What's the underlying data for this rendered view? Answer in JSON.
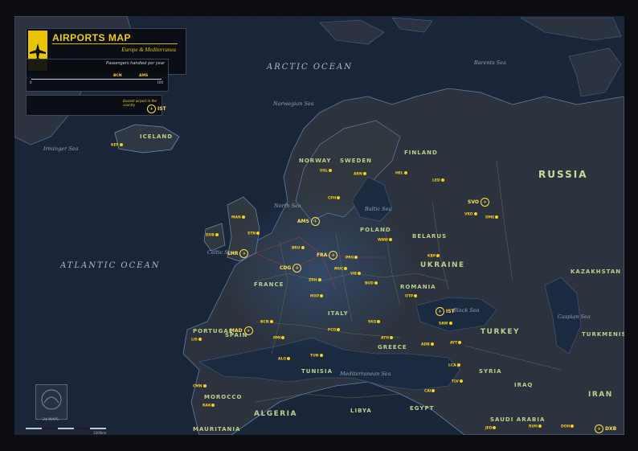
{
  "legend": {
    "title": "AIRPORTS MAP",
    "subtitle": "Europe & Mediterranea",
    "pax_caption": "Passengers handled per year",
    "pax_ticks": [
      "0",
      "100"
    ],
    "pax_marks": [
      "BCN",
      "AMS"
    ],
    "busy_caption": "Busiest airport in the country",
    "busy_code": "IST"
  },
  "oceans": {
    "arctic": "ARCTIC OCEAN",
    "atlantic": "ATLANTIC OCEAN"
  },
  "seas": {
    "barents": "Barents Sea",
    "norwegian": "Norwegian Sea",
    "irminger": "Irminger Sea",
    "north": "North Sea",
    "baltic": "Baltic Sea",
    "celtic": "Celtic Sea",
    "black": "Black Sea",
    "mediterranean": "Mediterranean Sea",
    "caspian": "Caspian Sea"
  },
  "countries": {
    "russia": "RUSSIA",
    "kazakhstan": "KAZAKHSTAN",
    "finland": "FINLAND",
    "sweden": "SWEDEN",
    "norway": "NORWAY",
    "iceland": "ICELAND",
    "ukraine": "UKRAINE",
    "poland": "POLAND",
    "belarus": "BELARUS",
    "france": "FRANCE",
    "spain": "SPAIN",
    "portugal": "PORTUGAL",
    "italy": "ITALY",
    "romania": "ROMANIA",
    "greece": "GREECE",
    "turkey": "TURKEY",
    "syria": "SYRIA",
    "iraq": "IRAQ",
    "iran": "IRAN",
    "turkmenistan": "TURKMENISTAN",
    "morocco": "MOROCCO",
    "algeria": "ALGERIA",
    "tunisia": "TUNISIA",
    "libya": "LIBYA",
    "egypt": "EGYPT",
    "saudi": "SAUDI ARABIA",
    "mauritania": "MAURITANIA"
  },
  "hubs": [
    {
      "code": "AMS"
    },
    {
      "code": "FRA"
    },
    {
      "code": "CDG"
    },
    {
      "code": "LHR"
    },
    {
      "code": "IST"
    },
    {
      "code": "SVO"
    },
    {
      "code": "MAD"
    },
    {
      "code": "DXB"
    }
  ],
  "airports": [
    "KEF",
    "OSL",
    "ARN",
    "HEL",
    "CPH",
    "DUB",
    "MAN",
    "STN",
    "BRU",
    "MUC",
    "ZRH",
    "VIE",
    "WAW",
    "PRG",
    "BUD",
    "FCO",
    "MXP",
    "LIS",
    "BCN",
    "PMI",
    "ATH",
    "SAW",
    "OTP",
    "KBP",
    "CAI",
    "TLV",
    "DOH",
    "RUH",
    "JED",
    "LED",
    "DME",
    "VKO",
    "AYT",
    "ADB",
    "LCA",
    "ALG",
    "CMN",
    "TUN",
    "RAK",
    "SKG"
  ],
  "brand": {
    "logo_text": "24 MAPS"
  },
  "scale": {
    "label": "1000km"
  }
}
